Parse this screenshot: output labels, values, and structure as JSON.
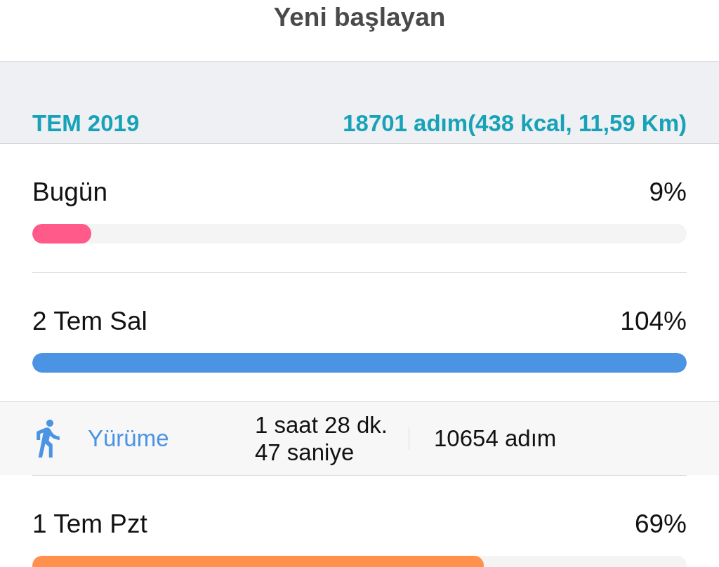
{
  "header": {
    "title": "Yeni başlayan"
  },
  "summary": {
    "month": "TEM 2019",
    "totals": "18701 adım(438 kcal, 11,59 Km)"
  },
  "days": [
    {
      "label": "Bugün",
      "percent": "9%",
      "level": 0.09,
      "color": "#ff5a8a"
    },
    {
      "label": "2 Tem Sal",
      "percent": "104%",
      "level": 1,
      "color": "#4a94e3",
      "activities": [
        {
          "kind": "walking",
          "name": "Yürüme",
          "duration": "1 saat 28 dk. 47 saniye",
          "steps": "10654 adım"
        }
      ]
    },
    {
      "label": "1 Tem Pzt",
      "percent": "69%",
      "level": 0.69,
      "color": "#ff914d"
    }
  ]
}
